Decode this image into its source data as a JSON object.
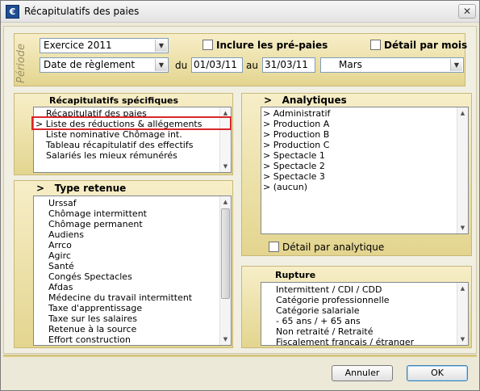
{
  "window": {
    "title": "Récapitulatifs des paies",
    "app_icon": "€"
  },
  "periode": {
    "label": "Période",
    "exercice": "Exercice 2011",
    "inclure_label": "Inclure les pré-paies",
    "detail_mois_label": "Détail par mois",
    "date_type": "Date de règlement",
    "du_label": "du",
    "date_from": "01/03/11",
    "au_label": "au",
    "date_to": "31/03/11",
    "month": "Mars"
  },
  "recap": {
    "header": "Récapitulatifs spécifiques",
    "items": [
      "Récapitulatif des paies",
      "> Liste des réductions & allégements",
      "Liste nominative Chômage int.",
      "Tableau récapitulatif des effectifs",
      "Salariés les mieux rémunérés"
    ],
    "selected_index": 1
  },
  "type_retenue": {
    "header": "Type retenue",
    "header_marker": ">",
    "items": [
      "Urssaf",
      "Chômage intermittent",
      "Chômage permanent",
      "Audiens",
      "Arrco",
      "Agirc",
      "Santé",
      "Congés Spectacles",
      "Afdas",
      "Médecine du travail intermittent",
      "Taxe d'apprentissage",
      "Taxe sur les salaires",
      "Retenue à la source",
      "Effort construction"
    ]
  },
  "analytiques": {
    "header": "Analytiques",
    "header_marker": ">",
    "items": [
      "> Administratif",
      "> Production A",
      "> Production B",
      "> Production C",
      "> Spectacle 1",
      "> Spectacle 2",
      "> Spectacle 3",
      "> (aucun)"
    ],
    "detail_label": "Détail par analytique"
  },
  "rupture": {
    "header": "Rupture",
    "items": [
      "Intermittent / CDI / CDD",
      "Catégorie professionnelle",
      "Catégorie salariale",
      "- 65 ans / + 65 ans",
      "Non retraité / Retraité",
      "Fiscalement français / étranger"
    ]
  },
  "buttons": {
    "cancel": "Annuler",
    "ok": "OK"
  }
}
